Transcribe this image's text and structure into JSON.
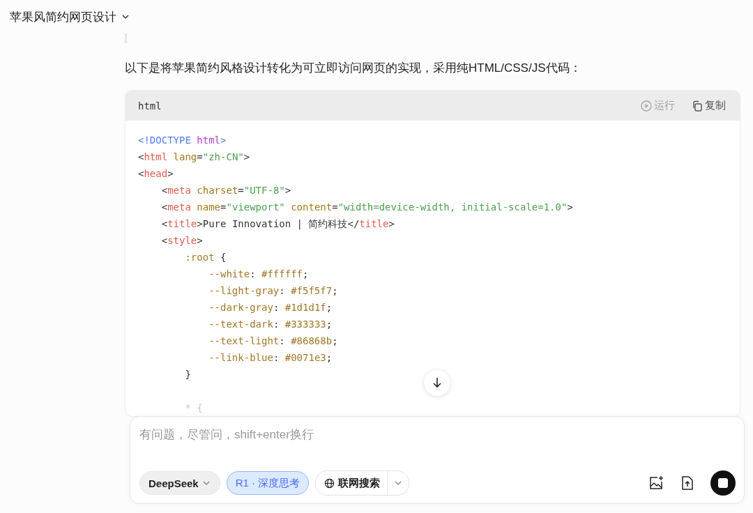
{
  "header": {
    "title": "苹果风简约网页设计"
  },
  "intro": "以下是将苹果简约风格设计转化为可立即访问网页的实现，采用纯HTML/CSS/JS代码：",
  "code_block": {
    "language": "html",
    "actions": [
      {
        "label": "运行",
        "disabled": true,
        "kind": "run"
      },
      {
        "label": "复制",
        "disabled": false,
        "kind": "copy"
      }
    ],
    "lines": [
      [
        {
          "kind": "keyword",
          "text": "<!DOCTYPE "
        },
        {
          "kind": "name",
          "text": "html"
        },
        {
          "kind": "keyword",
          "text": ">"
        }
      ],
      [
        {
          "kind": "punct",
          "text": "<"
        },
        {
          "kind": "tag",
          "text": "html"
        },
        {
          "kind": "attr",
          "text": " lang"
        },
        {
          "kind": "punct",
          "text": "="
        },
        {
          "kind": "string",
          "text": "\"zh-CN\""
        },
        {
          "kind": "punct",
          "text": ">"
        }
      ],
      [
        {
          "kind": "punct",
          "text": "<"
        },
        {
          "kind": "tag",
          "text": "head"
        },
        {
          "kind": "punct",
          "text": ">"
        }
      ],
      [
        {
          "kind": "punct",
          "text": "    <"
        },
        {
          "kind": "tag",
          "text": "meta"
        },
        {
          "kind": "attr",
          "text": " charset"
        },
        {
          "kind": "punct",
          "text": "="
        },
        {
          "kind": "string",
          "text": "\"UTF-8\""
        },
        {
          "kind": "punct",
          "text": ">"
        }
      ],
      [
        {
          "kind": "punct",
          "text": "    <"
        },
        {
          "kind": "tag",
          "text": "meta"
        },
        {
          "kind": "attr",
          "text": " name"
        },
        {
          "kind": "punct",
          "text": "="
        },
        {
          "kind": "string",
          "text": "\"viewport\""
        },
        {
          "kind": "attr",
          "text": " content"
        },
        {
          "kind": "punct",
          "text": "="
        },
        {
          "kind": "string",
          "text": "\"width=device-width, initial-scale=1.0\""
        },
        {
          "kind": "punct",
          "text": ">"
        }
      ],
      [
        {
          "kind": "punct",
          "text": "    <"
        },
        {
          "kind": "tag",
          "text": "title"
        },
        {
          "kind": "punct",
          "text": ">Pure Innovation | 简约科技</"
        },
        {
          "kind": "tag",
          "text": "title"
        },
        {
          "kind": "punct",
          "text": ">"
        }
      ],
      [
        {
          "kind": "punct",
          "text": "    <"
        },
        {
          "kind": "tag",
          "text": "style"
        },
        {
          "kind": "punct",
          "text": ">"
        }
      ],
      [
        {
          "kind": "prop",
          "text": "        :root"
        },
        {
          "kind": "punct",
          "text": " {"
        }
      ],
      [
        {
          "kind": "prop",
          "text": "            --white"
        },
        {
          "kind": "punct",
          "text": ": "
        },
        {
          "kind": "prop",
          "text": "#ffffff"
        },
        {
          "kind": "punct",
          "text": ";"
        }
      ],
      [
        {
          "kind": "prop",
          "text": "            --light-gray"
        },
        {
          "kind": "punct",
          "text": ": "
        },
        {
          "kind": "prop",
          "text": "#f5f5f7"
        },
        {
          "kind": "punct",
          "text": ";"
        }
      ],
      [
        {
          "kind": "prop",
          "text": "            --dark-gray"
        },
        {
          "kind": "punct",
          "text": ": "
        },
        {
          "kind": "prop",
          "text": "#1d1d1f"
        },
        {
          "kind": "punct",
          "text": ";"
        }
      ],
      [
        {
          "kind": "prop",
          "text": "            --text-dark"
        },
        {
          "kind": "punct",
          "text": ": "
        },
        {
          "kind": "prop",
          "text": "#333333"
        },
        {
          "kind": "punct",
          "text": ";"
        }
      ],
      [
        {
          "kind": "prop",
          "text": "            --text-light"
        },
        {
          "kind": "punct",
          "text": ": "
        },
        {
          "kind": "prop",
          "text": "#86868b"
        },
        {
          "kind": "punct",
          "text": ";"
        }
      ],
      [
        {
          "kind": "prop",
          "text": "            --link-blue"
        },
        {
          "kind": "punct",
          "text": ": "
        },
        {
          "kind": "prop",
          "text": "#0071e3"
        },
        {
          "kind": "punct",
          "text": ";"
        }
      ],
      [
        {
          "kind": "punct",
          "text": "        }"
        }
      ],
      [
        {
          "kind": "blank"
        }
      ],
      [
        {
          "kind": "faded",
          "text": "        * {"
        }
      ]
    ]
  },
  "composer": {
    "placeholder": "有问题，尽管问，shift+enter换行",
    "chips": [
      {
        "kind": "model",
        "label": "DeepSeek",
        "selected": false
      },
      {
        "kind": "toggle",
        "label": "R1 · 深度思考",
        "selected": true
      },
      {
        "kind": "split",
        "label": "联网搜索",
        "selected": false
      }
    ]
  }
}
